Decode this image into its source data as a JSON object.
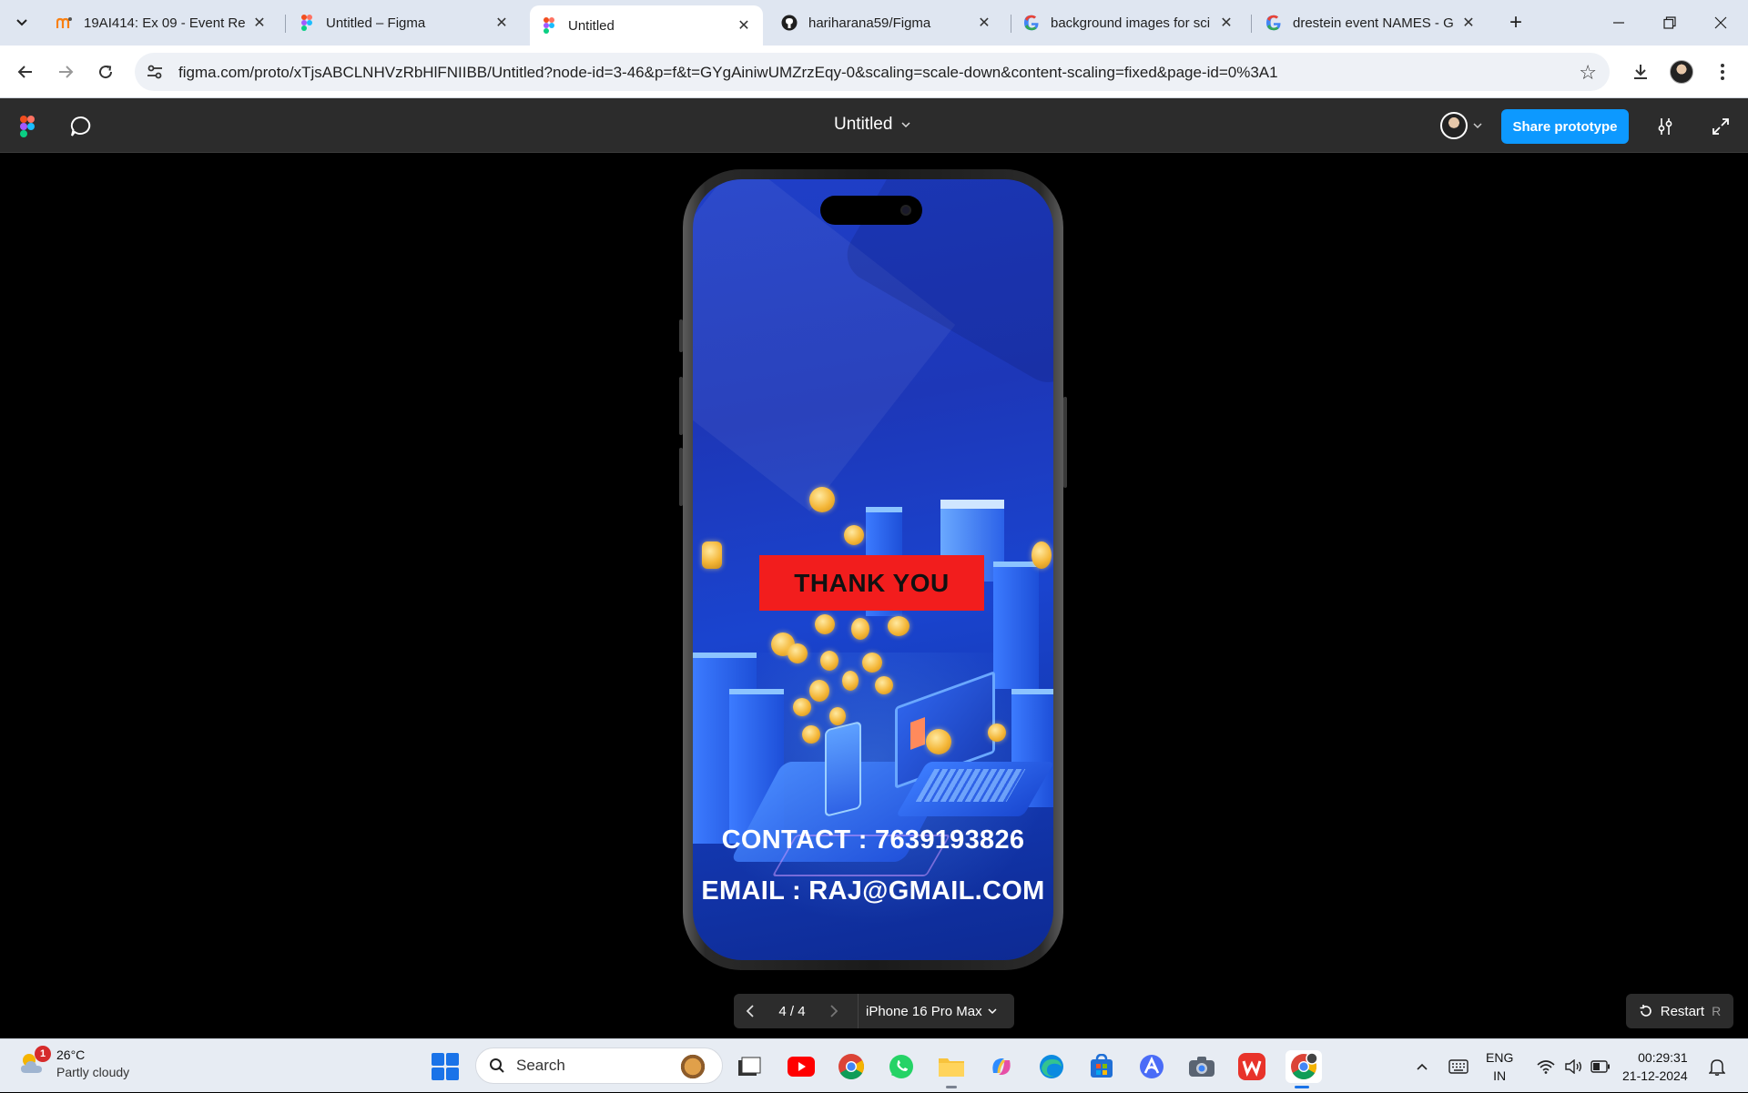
{
  "browser": {
    "tabs": [
      {
        "title": "19AI414: Ex 09 - Event Reg",
        "favicon": "moodle-icon"
      },
      {
        "title": "Untitled – Figma",
        "favicon": "figma-icon"
      },
      {
        "title": "Untitled",
        "favicon": "figma-icon",
        "active": true
      },
      {
        "title": "hariharana59/Figma",
        "favicon": "github-icon"
      },
      {
        "title": "background images for sci",
        "favicon": "google-icon"
      },
      {
        "title": "drestein event NAMES - G",
        "favicon": "google-icon"
      }
    ],
    "new_tab": "+",
    "url": "figma.com/proto/xTjsABCLNHVzRbHlFNIIBB/Untitled?node-id=3-46&p=f&t=GYgAiniwUMZrzEqy-0&scaling=scale-down&content-scaling=fixed&page-id=0%3A1"
  },
  "figma": {
    "file_title": "Untitled",
    "share_label": "Share prototype",
    "accent": "#0d99ff"
  },
  "prototype": {
    "thank_you": "THANK YOU",
    "contact": "CONTACT : 7639193826",
    "email": "EMAIL : RAJ@GMAIL.COM",
    "page_counter": "4 / 4",
    "device": "iPhone 16 Pro Max",
    "restart_label": "Restart",
    "restart_key": "R",
    "banner_color": "#f21d1d"
  },
  "taskbar": {
    "weather_temp": "26°C",
    "weather_cond": "Partly cloudy",
    "weather_badge": "1",
    "search_placeholder": "Search",
    "lang_top": "ENG",
    "lang_bottom": "IN",
    "time": "00:29:31",
    "date": "21-12-2024"
  }
}
